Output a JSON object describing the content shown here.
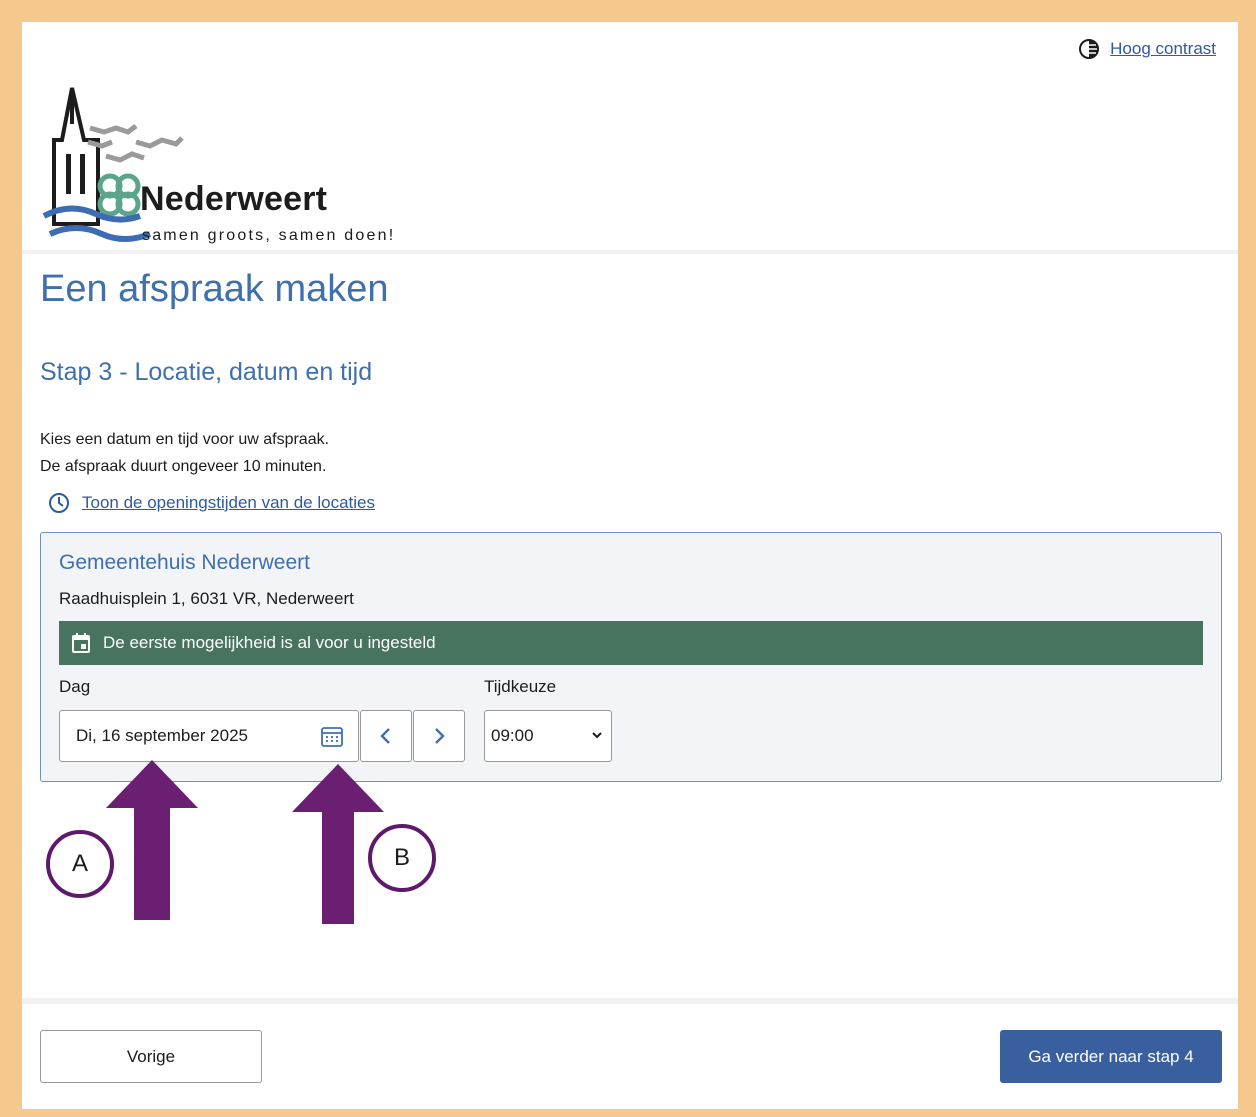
{
  "header": {
    "contrast_link": "Hoog contrast",
    "logo": {
      "name": "Nederweert",
      "tagline": "samen groots, samen doen!"
    }
  },
  "main": {
    "title": "Een afspraak maken",
    "step_title": "Stap 3 - Locatie, datum en tijd",
    "intro_line1": "Kies een datum en tijd voor uw afspraak.",
    "intro_line2": "De afspraak duurt ongeveer 10 minuten.",
    "hours_link": "Toon de openingstijden van de locaties"
  },
  "location": {
    "name": "Gemeentehuis Nederweert",
    "address": "Raadhuisplein 1, 6031 VR, Nederweert",
    "banner": "De eerste mogelijkheid is al voor u ingesteld",
    "day_label": "Dag",
    "day_value": "Di, 16 september 2025",
    "time_label": "Tijdkeuze",
    "time_value": "09:00"
  },
  "annotations": {
    "a": "A",
    "b": "B",
    "arrow_color": "#6b1f73"
  },
  "footer": {
    "prev_label": "Vorige",
    "next_label": "Ga verder naar stap 4"
  },
  "colors": {
    "frame": "#f5c98e",
    "heading": "#3f70ad",
    "banner": "#47735f",
    "primary_button": "#3a5f9e"
  }
}
